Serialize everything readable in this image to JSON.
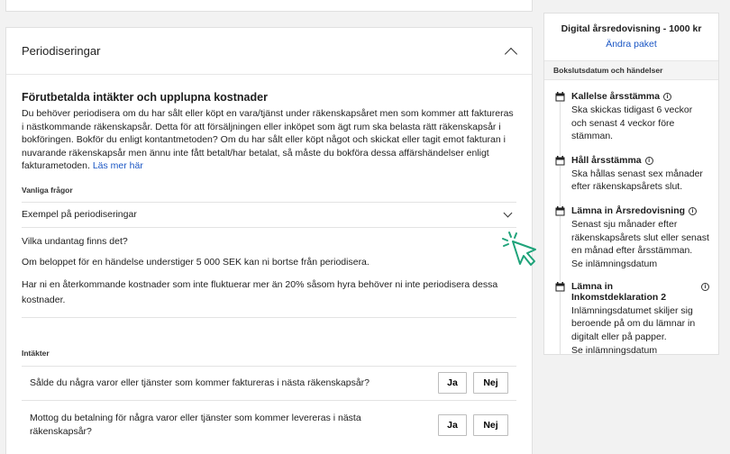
{
  "section": {
    "header_title": "Periodiseringar",
    "title": "Förutbetalda intäkter och upplupna kostnader",
    "description": "Du behöver periodisera om du har sålt eller köpt en vara/tjänst under räkenskapsåret men som kommer att faktureras i nästkommande räkenskapsår. Detta för att försäljningen eller inköpet som ägt rum ska belasta rätt räkenskapsår i bokföringen. Bokför du enligt kontantmetoden? Om du har sålt eller köpt något och skickat eller tagit emot fakturan i nuvarande räkenskapsår men ännu inte fått betalt/har betalat, så måste du bokföra dessa affärshändelser enligt fakturametoden.",
    "read_more": "Läs mer här"
  },
  "faq": {
    "label": "Vanliga frågor",
    "item_1": "Exempel på periodiseringar",
    "item_2": "Vilka undantag finns det?",
    "answer_1": "Om beloppet för en händelse understiger 5 000 SEK kan ni bortse från periodisera.",
    "answer_2": "Har ni en återkommande kostnader som inte fluktuerar mer än 20% såsom hyra behöver ni inte periodisera dessa kostnader."
  },
  "intakter": {
    "label": "Intäkter",
    "q1": "Sålde du några varor eller tjänster som kommer faktureras i nästa räkenskapsår?",
    "q2": "Mottog du betalning för några varor eller tjänster som kommer levereras i nästa räkenskapsår?",
    "yes": "Ja",
    "no": "Nej"
  },
  "sidebar": {
    "package_title": "Digital årsredovisning - 1000 kr",
    "change_package": "Ändra paket",
    "subheader": "Bokslutsdatum och händelser",
    "events": [
      {
        "title": "Kallelse årsstämma",
        "text": "Ska skickas tidigast 6 veckor och senast 4 veckor före stämman.",
        "link": ""
      },
      {
        "title": "Håll årsstämma",
        "text": "Ska hållas senast sex månader efter räkenskapsårets slut.",
        "link": ""
      },
      {
        "title": "Lämna in Årsredovisning",
        "text": "Senast sju månader efter räkenskapsårets slut eller senast en månad efter årsstämman.",
        "link": "Se inlämningsdatum"
      },
      {
        "title": "Lämna in Inkomstdeklaration 2",
        "text": "Inlämningsdatumet skiljer sig beroende på om du lämnar in digitalt eller på papper.",
        "link": "Se inlämningsdatum"
      }
    ],
    "info_glyph": "i"
  },
  "colors": {
    "link": "#1a56c4",
    "cursor": "#1fa37a"
  }
}
